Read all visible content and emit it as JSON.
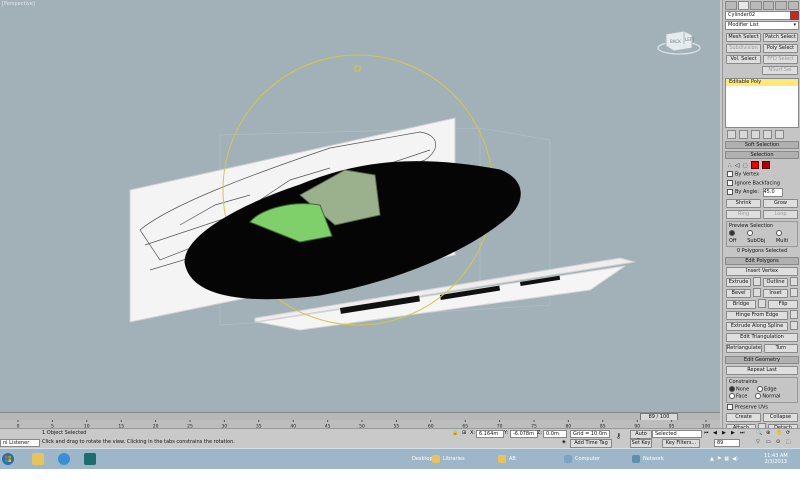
{
  "viewport": {
    "label": "[Perspective]",
    "viewcube": {
      "front": "BACK",
      "right": "LEFT"
    }
  },
  "command_panel": {
    "object_name": "Cylinder02",
    "object_color": "#d42020",
    "modifier_list": "Modifier List",
    "modifier_buttons": [
      [
        "Mesh Select",
        "Patch Select"
      ],
      [
        "Subdivision",
        "Poly Select"
      ],
      [
        "Vol. Select",
        "FFD Select"
      ],
      [
        "",
        "NSurf Sel"
      ]
    ],
    "stack": [
      "Editable Poly"
    ],
    "soft_selection": "Soft Selection",
    "selection": {
      "title": "Selection",
      "by_vertex": "By Vertex",
      "ignore_backfacing": "Ignore Backfacing",
      "by_angle": "By Angle:",
      "angle_value": "45.0",
      "shrink": "Shrink",
      "grow": "Grow",
      "ring": "Ring",
      "loop": "Loop",
      "preview": "Preview Selection",
      "preview_opts": [
        "Off",
        "SubObj",
        "Multi"
      ],
      "status": "0 Polygons Selected"
    },
    "edit_polygons": {
      "title": "Edit Polygons",
      "insert_vertex": "Insert Vertex",
      "rows": [
        [
          "Extrude",
          "Outline"
        ],
        [
          "Bevel",
          "Inset"
        ],
        [
          "Bridge",
          "Flip"
        ]
      ],
      "hinge": "Hinge From Edge",
      "extrude_spline": "Extrude Along Spline",
      "edit_tri": "Edit Triangulation",
      "retri": "Retriangulate",
      "turn": "Turn"
    },
    "edit_geometry": {
      "title": "Edit Geometry",
      "repeat_last": "Repeat Last",
      "constraints": "Constraints",
      "c_opts": [
        [
          "None",
          "Edge"
        ],
        [
          "Face",
          "Normal"
        ]
      ],
      "preserve_uvs": "Preserve UVs",
      "create": "Create",
      "collapse": "Collapse",
      "attach": "Attach",
      "detach": "Detach"
    }
  },
  "time_slider": {
    "value": "89 / 100",
    "ticks": [
      "0",
      "5",
      "10",
      "15",
      "20",
      "25",
      "30",
      "35",
      "40",
      "45",
      "50",
      "55",
      "60",
      "65",
      "70",
      "75",
      "80",
      "85",
      "90",
      "95",
      "100"
    ]
  },
  "status": {
    "listener": "ni Listener",
    "objects": "1 Object Selected",
    "prompt": "Click and drag to rotate the view.  Clicking in the tabs constrains the rotation.",
    "x": "6.164m",
    "y": "-6.078m",
    "z": "0.0m",
    "grid": "Grid = 10.0m",
    "add_time_tag": "Add Time Tag",
    "auto_key": "Auto Key",
    "set_key": "Set Key",
    "selected": "Selected",
    "key_filters": "Key Filters...",
    "frame": "89"
  },
  "taskbar": {
    "desktop": "Desktop",
    "libraries": "Libraries",
    "ab": "AB",
    "computer": "Computer",
    "network": "Network",
    "time": "11:43 AM",
    "date": "2/3/2013"
  },
  "colors": {
    "viewport_bg": "#a2b1b7",
    "accent_selection": "#ffe97a",
    "taskbar": "#9db7c9"
  }
}
